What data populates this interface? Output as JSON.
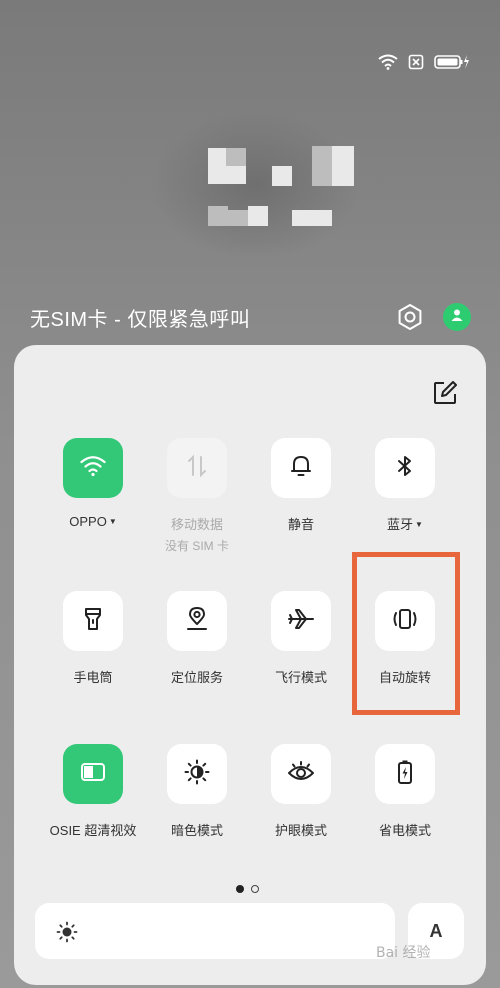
{
  "status_bar": {
    "icons": [
      "wifi-icon",
      "no-sim-icon",
      "battery-charging-icon"
    ]
  },
  "lockscreen": {
    "sim_status": "无SIM卡 - 仅限紧急呼叫"
  },
  "quick_settings": {
    "tiles": [
      {
        "id": "wifi",
        "label": "OPPO",
        "has_caret": true,
        "state": "on",
        "icon": "wifi-icon"
      },
      {
        "id": "mobile-data",
        "label": "移动数据",
        "sublabel": "没有 SIM 卡",
        "state": "disabled",
        "icon": "mobile-data-icon"
      },
      {
        "id": "mute",
        "label": "静音",
        "state": "off",
        "icon": "bell-icon"
      },
      {
        "id": "bluetooth",
        "label": "蓝牙",
        "has_caret": true,
        "state": "off",
        "icon": "bluetooth-icon"
      },
      {
        "id": "flashlight",
        "label": "手电筒",
        "state": "off",
        "icon": "flashlight-icon"
      },
      {
        "id": "location",
        "label": "定位服务",
        "state": "off",
        "icon": "location-pin-icon"
      },
      {
        "id": "airplane",
        "label": "飞行模式",
        "state": "off",
        "icon": "airplane-icon"
      },
      {
        "id": "auto-rotate",
        "label": "自动旋转",
        "state": "off",
        "icon": "auto-rotate-icon",
        "highlighted": true
      },
      {
        "id": "osie",
        "label": "OSIE 超清视效",
        "state": "on",
        "icon": "osie-icon"
      },
      {
        "id": "dark-mode",
        "label": "暗色模式",
        "state": "off",
        "icon": "dark-mode-icon"
      },
      {
        "id": "eye-care",
        "label": "护眼模式",
        "state": "off",
        "icon": "eye-icon"
      },
      {
        "id": "power-saving",
        "label": "省电模式",
        "state": "off",
        "icon": "battery-saver-icon"
      }
    ],
    "page_indicator": {
      "current": 1,
      "total": 2
    },
    "font_button_label": "A"
  },
  "colors": {
    "accent_green": "#33c878",
    "highlight_orange": "#e8663c",
    "panel_bg": "#ededed"
  },
  "watermark": "Bai 经验"
}
